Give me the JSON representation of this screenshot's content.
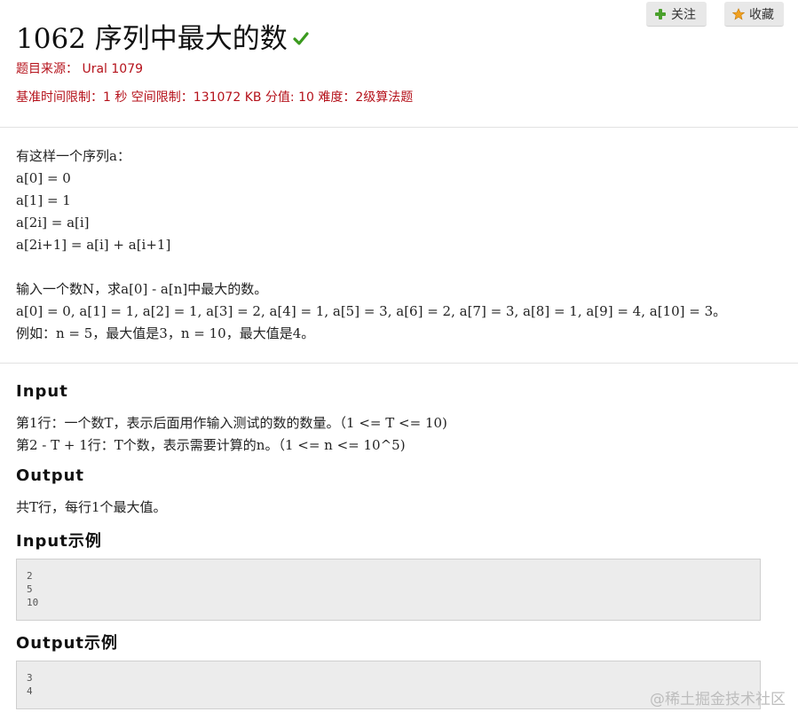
{
  "problem": {
    "title": "1062 序列中最大的数",
    "source_label": "题目来源：",
    "source_value": "Ural 1079",
    "limits": "基准时间限制：1 秒 空间限制：131072 KB 分值: 10 难度：2级算法题"
  },
  "actions": {
    "follow_label": "关注",
    "favorite_label": "收藏"
  },
  "description": {
    "lines": [
      "有这样一个序列a：",
      "a[0] = 0",
      "a[1] = 1",
      "a[2i] = a[i]",
      "a[2i+1] = a[i] + a[i+1]",
      "",
      "输入一个数N，求a[0] - a[n]中最大的数。",
      "a[0] = 0, a[1] = 1, a[2] = 1, a[3] = 2, a[4] = 1, a[5] = 3, a[6] = 2, a[7] = 3, a[8] = 1, a[9] = 4, a[10] = 3。",
      "例如：n = 5，最大值是3，n = 10，最大值是4。"
    ]
  },
  "input": {
    "heading": "Input",
    "lines": [
      "第1行：一个数T，表示后面用作输入测试的数的数量。（1 <= T <= 10)",
      "第2 - T + 1行：T个数，表示需要计算的n。（1 <= n <= 10^5)"
    ]
  },
  "output": {
    "heading": "Output",
    "lines": [
      "共T行，每行1个最大值。"
    ]
  },
  "input_example": {
    "heading": "Input示例",
    "lines": [
      "2",
      "5",
      "10"
    ]
  },
  "output_example": {
    "heading": "Output示例",
    "lines": [
      "3",
      "4"
    ]
  },
  "watermark": "@稀土掘金技术社区",
  "colors": {
    "accent_red": "#b5121b",
    "check_green": "#3a9a1e",
    "plus_green": "#4aa02c",
    "star_orange": "#f0a020"
  }
}
